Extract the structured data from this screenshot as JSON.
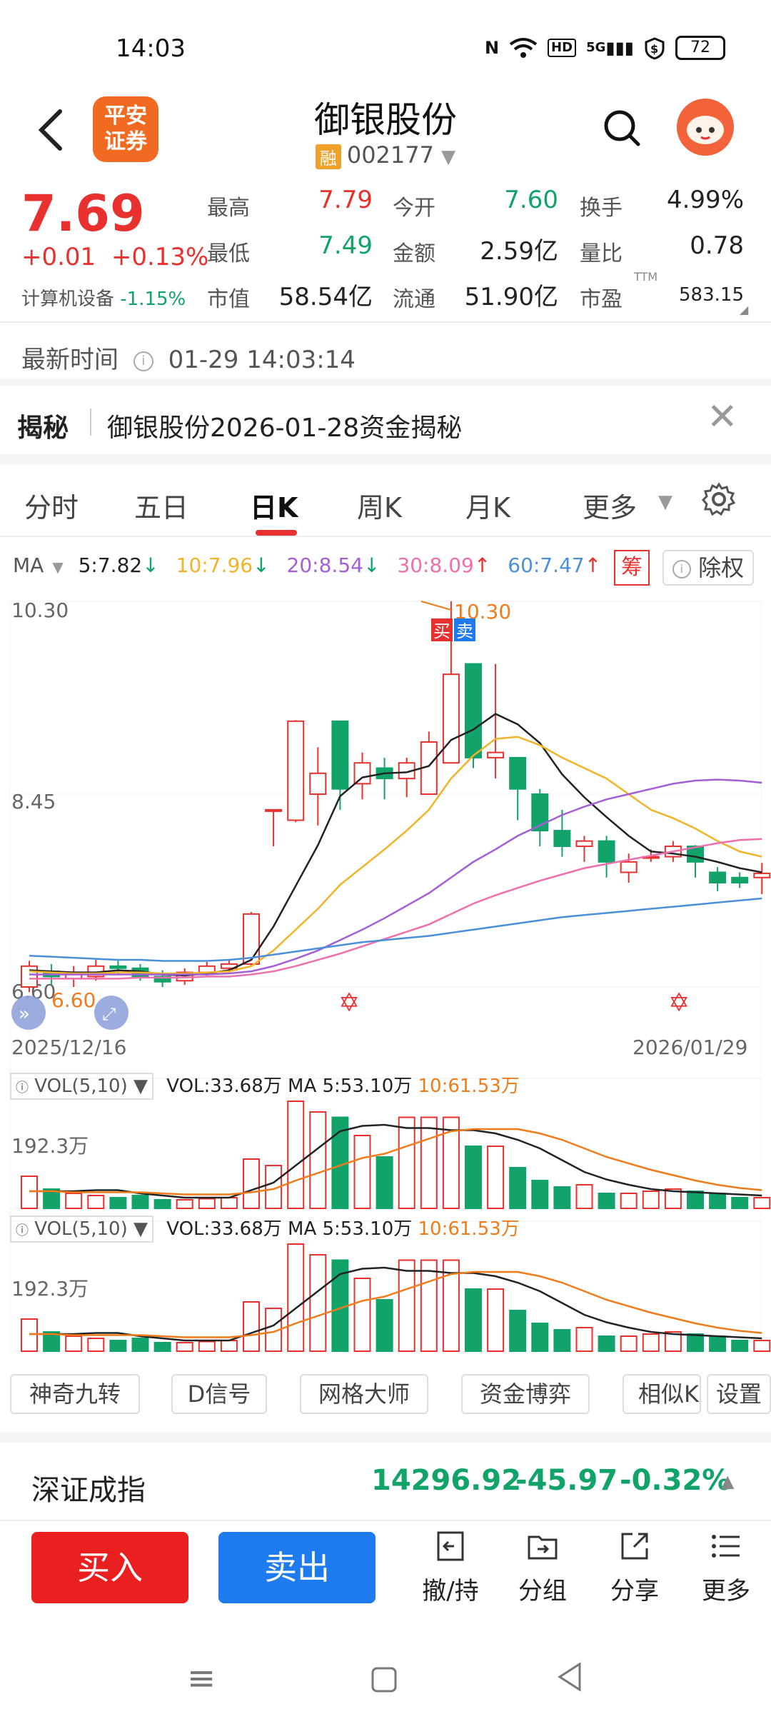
{
  "status_bar": {
    "time": "14:03",
    "net": "5G",
    "battery": "72"
  },
  "header": {
    "logo_text": "平安证券",
    "title": "御银股份",
    "badge": "融",
    "code": "002177"
  },
  "quote": {
    "price": "7.69",
    "change": "+0.01",
    "change_pct": "+0.13%",
    "sector_name": "计算机设备",
    "sector_pct": "-1.15%",
    "fields": [
      {
        "label": "最高",
        "value": "7.79",
        "color": "red"
      },
      {
        "label": "今开",
        "value": "7.60",
        "color": "green"
      },
      {
        "label": "换手",
        "value": "4.99%",
        "color": "black"
      },
      {
        "label": "最低",
        "value": "7.49",
        "color": "green"
      },
      {
        "label": "金额",
        "value": "2.59亿",
        "color": "black"
      },
      {
        "label": "量比",
        "value": "0.78",
        "color": "black"
      },
      {
        "label": "市值",
        "value": "58.54亿",
        "color": "black"
      },
      {
        "label": "流通",
        "value": "51.90亿",
        "color": "black"
      },
      {
        "label": "市盈",
        "value": "583.15",
        "color": "black"
      }
    ],
    "ttm_label": "TTM"
  },
  "update": {
    "label": "最新时间",
    "value": "01-29 14:03:14"
  },
  "reveal": {
    "tag": "揭秘",
    "text": "御银股份2026-01-28资金揭秘"
  },
  "tabs": [
    "分时",
    "五日",
    "日K",
    "周K",
    "月K",
    "更多"
  ],
  "active_tab": "日K",
  "ma": {
    "label": "MA",
    "items": [
      {
        "text": "5:7.82",
        "arrow": "↓",
        "color": "#222222"
      },
      {
        "text": "10:7.96",
        "arrow": "↓",
        "color": "#f0b429"
      },
      {
        "text": "20:8.54",
        "arrow": "↓",
        "color": "#a45fd6"
      },
      {
        "text": "30:8.09",
        "arrow": "↑",
        "color": "#ef6fae"
      },
      {
        "text": "60:7.47",
        "arrow": "↑",
        "color": "#4a90d9"
      }
    ],
    "chou": "筹",
    "chuquan": "除权"
  },
  "chart": {
    "y_high": "10.30",
    "y_mid": "8.45",
    "y_low": "6.60",
    "max_mark": "10.30",
    "min_mark": "6.60",
    "buy": "买",
    "sell": "卖",
    "date_start": "2025/12/16",
    "date_end": "2026/01/29"
  },
  "vol1": {
    "btn": "VOL(5,10)",
    "vol": "VOL:33.68万",
    "ma5": "MA 5:53.10万",
    "ma10": "10:61.53万",
    "scale": "192.3万"
  },
  "vol2": {
    "btn": "VOL(5,10)",
    "vol": "VOL:33.68万",
    "ma5": "MA 5:53.10万",
    "ma10": "10:61.53万",
    "scale": "192.3万"
  },
  "indicators": [
    "神奇九转",
    "D信号",
    "网格大师",
    "资金博弈",
    "相似K"
  ],
  "settings": "设置",
  "index": {
    "name": "深证成指",
    "value": "14296.92",
    "change": "-45.97",
    "pct": "-0.32%"
  },
  "actions": {
    "buy": "买入",
    "sell": "卖出",
    "items": [
      "撤/持",
      "分组",
      "分享",
      "更多"
    ]
  },
  "colors": {
    "up": "#e8312f",
    "down": "#11a36a",
    "buy_btn": "#ea1f1f",
    "sell_btn": "#1e7bef"
  }
}
